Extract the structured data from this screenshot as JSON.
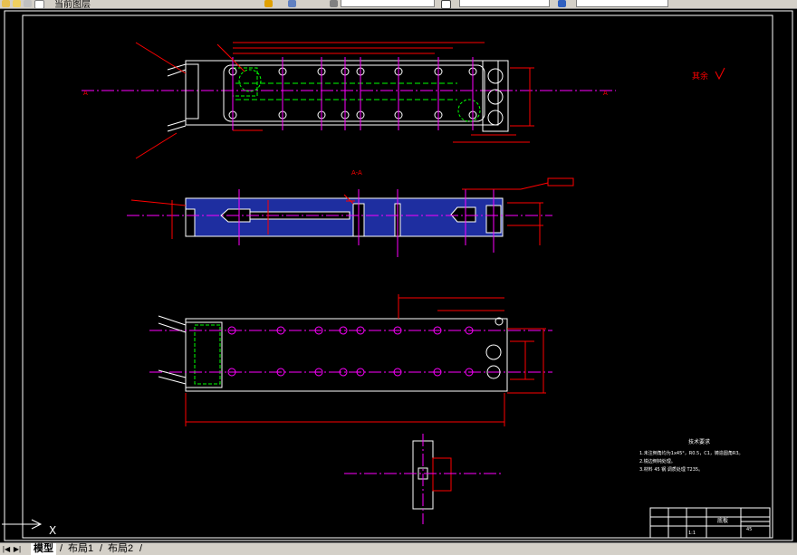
{
  "toolbar": {
    "layer_name": "当前图层",
    "linetype_value": "",
    "lineweight_value": ""
  },
  "ucs": {
    "x_label": "X"
  },
  "drawing": {
    "roughness_note": "其余",
    "section_labels": [
      "A",
      "A",
      "A-A"
    ],
    "tech_title": "技术要求",
    "tech_lines": [
      "1.未注倒角均为1x45°，R0.5，C1，铸造圆角R3。",
      "2.锐边倒钝处理。",
      "3.材料 45 钢 调质处理 T235。"
    ],
    "title_block": {
      "part_name": "底板",
      "drawing_no": "",
      "material": "45",
      "scale": "1:1"
    }
  },
  "tabs": {
    "items": [
      "模型",
      "布局1",
      "布局2"
    ],
    "active": 0
  }
}
